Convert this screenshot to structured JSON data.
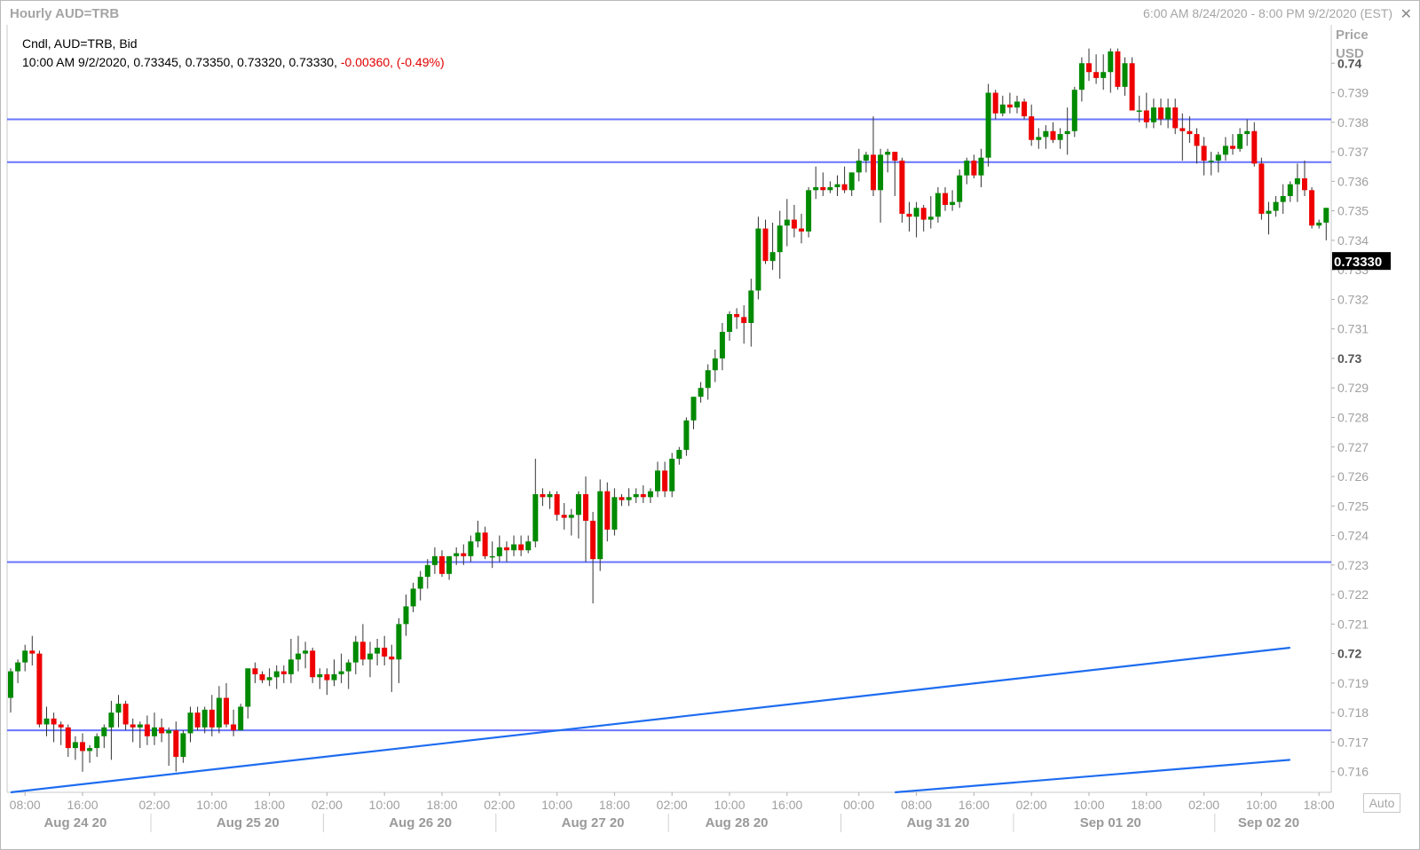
{
  "window": {
    "title": "Hourly AUD=TRB",
    "range": "6:00 AM 8/24/2020 - 8:00 PM 9/2/2020 (EST)",
    "close_icon": "close-icon"
  },
  "legend": {
    "line1": "Cndl, AUD=TRB, Bid",
    "line2_prefix": "10:00 AM 9/2/2020, 0.73345, 0.73350, 0.73320, 0.73330,",
    "change": "-0.00360, (-0.49%)"
  },
  "price_axis": {
    "header1": "Price",
    "header2": "USD",
    "current_label": "0.73330",
    "auto_label": "Auto"
  },
  "colors": {
    "up": "#008a00",
    "down": "#ee0000",
    "hline": "#6a74ff",
    "trend": "#1e6cf0",
    "badge": "#000000"
  },
  "chart_data": {
    "type": "candlestick",
    "ylim": [
      0.7153,
      0.7413
    ],
    "y_ticks": [
      "0.74",
      "0.739",
      "0.738",
      "0.737",
      "0.736",
      "0.735",
      "0.734",
      "0.733",
      "0.732",
      "0.731",
      "0.73",
      "0.729",
      "0.728",
      "0.727",
      "0.726",
      "0.725",
      "0.724",
      "0.723",
      "0.722",
      "0.721",
      "0.72",
      "0.719",
      "0.718",
      "0.717",
      "0.716"
    ],
    "major_y_ticks": [
      "0.74",
      "0.73",
      "0.72"
    ],
    "x_ticks": [
      "08:00",
      "16:00",
      "02:00",
      "10:00",
      "18:00",
      "02:00",
      "10:00",
      "18:00",
      "02:00",
      "10:00",
      "18:00",
      "02:00",
      "10:00",
      "16:00",
      "00:00",
      "08:00",
      "16:00",
      "02:00",
      "10:00",
      "18:00",
      "02:00",
      "10:00",
      "18:00"
    ],
    "date_labels": [
      "Aug 24 20",
      "Aug 25 20",
      "Aug 26 20",
      "Aug 27 20",
      "Aug 28 20",
      "Aug 31 20",
      "Sep 01 20",
      "Sep 02 20"
    ],
    "horizontal_lines": [
      0.7381,
      0.73665,
      0.7231,
      0.7174
    ],
    "trend_lines": [
      {
        "from_bar": 0,
        "from": 0.7153,
        "to_bar": 178,
        "to": 0.7202
      },
      {
        "from_bar": 123,
        "from": 0.7153,
        "to_bar": 178,
        "to": 0.7164
      }
    ],
    "candles": [
      [
        0.7185,
        0.7195,
        0.718,
        0.7194
      ],
      [
        0.7194,
        0.7198,
        0.719,
        0.7197
      ],
      [
        0.7197,
        0.7203,
        0.7194,
        0.7201
      ],
      [
        0.7201,
        0.7206,
        0.7196,
        0.72
      ],
      [
        0.72,
        0.7201,
        0.7175,
        0.7176
      ],
      [
        0.7176,
        0.7182,
        0.7172,
        0.7178
      ],
      [
        0.7178,
        0.718,
        0.717,
        0.7176
      ],
      [
        0.7176,
        0.7177,
        0.7169,
        0.7175
      ],
      [
        0.7175,
        0.7176,
        0.7165,
        0.7168
      ],
      [
        0.7168,
        0.7172,
        0.7164,
        0.717
      ],
      [
        0.717,
        0.7173,
        0.716,
        0.7167
      ],
      [
        0.7167,
        0.7169,
        0.7163,
        0.7168
      ],
      [
        0.7168,
        0.7173,
        0.7165,
        0.7172
      ],
      [
        0.7172,
        0.7176,
        0.7168,
        0.7175
      ],
      [
        0.7175,
        0.7184,
        0.7164,
        0.718
      ],
      [
        0.718,
        0.7186,
        0.7175,
        0.7183
      ],
      [
        0.7183,
        0.7184,
        0.7174,
        0.7176
      ],
      [
        0.7176,
        0.7178,
        0.717,
        0.7175
      ],
      [
        0.7175,
        0.7177,
        0.7168,
        0.7176
      ],
      [
        0.7176,
        0.7179,
        0.7169,
        0.7172
      ],
      [
        0.7172,
        0.718,
        0.7169,
        0.7175
      ],
      [
        0.7175,
        0.7178,
        0.717,
        0.7173
      ],
      [
        0.7173,
        0.7175,
        0.7162,
        0.7174
      ],
      [
        0.7174,
        0.7177,
        0.716,
        0.7165
      ],
      [
        0.7165,
        0.7174,
        0.7163,
        0.7173
      ],
      [
        0.7173,
        0.7182,
        0.717,
        0.718
      ],
      [
        0.718,
        0.7182,
        0.7174,
        0.7175
      ],
      [
        0.7175,
        0.7182,
        0.7173,
        0.7181
      ],
      [
        0.7181,
        0.7186,
        0.7172,
        0.7175
      ],
      [
        0.7175,
        0.7189,
        0.7173,
        0.7185
      ],
      [
        0.7185,
        0.719,
        0.7175,
        0.7176
      ],
      [
        0.7176,
        0.7181,
        0.7172,
        0.7174
      ],
      [
        0.7174,
        0.7183,
        0.7174,
        0.7182
      ],
      [
        0.7182,
        0.7189,
        0.7178,
        0.7195
      ],
      [
        0.7195,
        0.7197,
        0.719,
        0.7193
      ],
      [
        0.7193,
        0.7194,
        0.719,
        0.7191
      ],
      [
        0.7191,
        0.7195,
        0.7189,
        0.7192
      ],
      [
        0.7192,
        0.7196,
        0.7188,
        0.7194
      ],
      [
        0.7194,
        0.7196,
        0.719,
        0.7193
      ],
      [
        0.7193,
        0.7205,
        0.719,
        0.7198
      ],
      [
        0.7198,
        0.7206,
        0.7194,
        0.72
      ],
      [
        0.72,
        0.7204,
        0.7195,
        0.7201
      ],
      [
        0.7201,
        0.7202,
        0.719,
        0.7192
      ],
      [
        0.7192,
        0.7195,
        0.7188,
        0.7193
      ],
      [
        0.7193,
        0.7195,
        0.7186,
        0.7191
      ],
      [
        0.7191,
        0.7198,
        0.7189,
        0.7193
      ],
      [
        0.7193,
        0.72,
        0.719,
        0.7194
      ],
      [
        0.7194,
        0.7198,
        0.7188,
        0.7197
      ],
      [
        0.7197,
        0.7206,
        0.7193,
        0.7204
      ],
      [
        0.7204,
        0.721,
        0.7196,
        0.7198
      ],
      [
        0.7198,
        0.7204,
        0.7192,
        0.72
      ],
      [
        0.72,
        0.7205,
        0.7196,
        0.7202
      ],
      [
        0.7202,
        0.7206,
        0.7196,
        0.7199
      ],
      [
        0.7199,
        0.7203,
        0.7187,
        0.7198
      ],
      [
        0.7198,
        0.7212,
        0.719,
        0.721
      ],
      [
        0.721,
        0.722,
        0.7206,
        0.7216
      ],
      [
        0.7216,
        0.7224,
        0.7214,
        0.7222
      ],
      [
        0.7222,
        0.7228,
        0.7218,
        0.7226
      ],
      [
        0.7226,
        0.7232,
        0.7222,
        0.723
      ],
      [
        0.723,
        0.7236,
        0.7227,
        0.7233
      ],
      [
        0.7233,
        0.7235,
        0.7226,
        0.7227
      ],
      [
        0.7227,
        0.7233,
        0.7225,
        0.7233
      ],
      [
        0.7233,
        0.7236,
        0.723,
        0.7234
      ],
      [
        0.7234,
        0.7237,
        0.723,
        0.7233
      ],
      [
        0.7233,
        0.724,
        0.7231,
        0.7238
      ],
      [
        0.7238,
        0.7245,
        0.7236,
        0.7241
      ],
      [
        0.7241,
        0.7243,
        0.7232,
        0.7233
      ],
      [
        0.7233,
        0.7238,
        0.7229,
        0.7233
      ],
      [
        0.7233,
        0.724,
        0.7231,
        0.7236
      ],
      [
        0.7236,
        0.7238,
        0.7231,
        0.7235
      ],
      [
        0.7235,
        0.724,
        0.7233,
        0.7237
      ],
      [
        0.7237,
        0.724,
        0.7233,
        0.7235
      ],
      [
        0.7235,
        0.724,
        0.7234,
        0.7238
      ],
      [
        0.7238,
        0.7266,
        0.7236,
        0.7254
      ],
      [
        0.7254,
        0.7256,
        0.725,
        0.7253
      ],
      [
        0.7253,
        0.7255,
        0.7249,
        0.7254
      ],
      [
        0.7254,
        0.7255,
        0.7245,
        0.7247
      ],
      [
        0.7247,
        0.7251,
        0.7242,
        0.7246
      ],
      [
        0.7246,
        0.7249,
        0.724,
        0.7247
      ],
      [
        0.7247,
        0.7255,
        0.7239,
        0.7254
      ],
      [
        0.7254,
        0.726,
        0.7231,
        0.7245
      ],
      [
        0.7245,
        0.7248,
        0.7217,
        0.7232
      ],
      [
        0.7232,
        0.7259,
        0.7228,
        0.7255
      ],
      [
        0.7255,
        0.7258,
        0.7238,
        0.7242
      ],
      [
        0.7242,
        0.7256,
        0.724,
        0.7253
      ],
      [
        0.7253,
        0.7254,
        0.725,
        0.7252
      ],
      [
        0.7252,
        0.7256,
        0.725,
        0.7253
      ],
      [
        0.7253,
        0.7256,
        0.7251,
        0.7254
      ],
      [
        0.7254,
        0.7257,
        0.7251,
        0.7253
      ],
      [
        0.7253,
        0.7256,
        0.7251,
        0.7255
      ],
      [
        0.7255,
        0.7265,
        0.7253,
        0.7262
      ],
      [
        0.7262,
        0.7265,
        0.7253,
        0.7255
      ],
      [
        0.7255,
        0.7268,
        0.7253,
        0.7266
      ],
      [
        0.7266,
        0.727,
        0.7264,
        0.7269
      ],
      [
        0.7269,
        0.728,
        0.7267,
        0.7279
      ],
      [
        0.7279,
        0.7286,
        0.7276,
        0.7287
      ],
      [
        0.7287,
        0.7292,
        0.7285,
        0.729
      ],
      [
        0.729,
        0.7298,
        0.7286,
        0.7296
      ],
      [
        0.7296,
        0.7303,
        0.7292,
        0.73
      ],
      [
        0.73,
        0.7312,
        0.7296,
        0.7309
      ],
      [
        0.7309,
        0.7316,
        0.7306,
        0.7315
      ],
      [
        0.7315,
        0.7317,
        0.731,
        0.7314
      ],
      [
        0.7314,
        0.7318,
        0.7305,
        0.7312
      ],
      [
        0.7312,
        0.7327,
        0.7304,
        0.7323
      ],
      [
        0.7323,
        0.7348,
        0.732,
        0.7344
      ],
      [
        0.7344,
        0.7347,
        0.7332,
        0.7333
      ],
      [
        0.7333,
        0.7346,
        0.733,
        0.7336
      ],
      [
        0.7336,
        0.735,
        0.7327,
        0.7345
      ],
      [
        0.7345,
        0.7354,
        0.7338,
        0.7347
      ],
      [
        0.7347,
        0.7352,
        0.7341,
        0.7344
      ],
      [
        0.7344,
        0.7349,
        0.7339,
        0.7343
      ],
      [
        0.7343,
        0.7358,
        0.7341,
        0.7357
      ],
      [
        0.7357,
        0.7365,
        0.7354,
        0.7358
      ],
      [
        0.7358,
        0.7363,
        0.7355,
        0.7357
      ],
      [
        0.7357,
        0.736,
        0.7356,
        0.7358
      ],
      [
        0.7358,
        0.7362,
        0.7355,
        0.7359
      ],
      [
        0.7359,
        0.7365,
        0.7356,
        0.7357
      ],
      [
        0.7357,
        0.7363,
        0.7355,
        0.7363
      ],
      [
        0.7363,
        0.7371,
        0.736,
        0.7367
      ],
      [
        0.7367,
        0.737,
        0.7363,
        0.7369
      ],
      [
        0.7369,
        0.7382,
        0.7355,
        0.7357
      ],
      [
        0.7357,
        0.7371,
        0.7346,
        0.7369
      ],
      [
        0.7369,
        0.7371,
        0.7363,
        0.737
      ],
      [
        0.737,
        0.7367,
        0.7355,
        0.7367
      ],
      [
        0.7367,
        0.7368,
        0.7346,
        0.7349
      ],
      [
        0.7349,
        0.7353,
        0.7343,
        0.7348
      ],
      [
        0.7348,
        0.7353,
        0.7341,
        0.7351
      ],
      [
        0.7351,
        0.7352,
        0.7343,
        0.7347
      ],
      [
        0.7347,
        0.7355,
        0.7344,
        0.7348
      ],
      [
        0.7348,
        0.7358,
        0.7346,
        0.7356
      ],
      [
        0.7356,
        0.7358,
        0.735,
        0.7352
      ],
      [
        0.7352,
        0.7357,
        0.735,
        0.7353
      ],
      [
        0.7353,
        0.7364,
        0.7351,
        0.7362
      ],
      [
        0.7362,
        0.7368,
        0.7359,
        0.7367
      ],
      [
        0.7367,
        0.7369,
        0.7361,
        0.7362
      ],
      [
        0.7362,
        0.7371,
        0.7358,
        0.7368
      ],
      [
        0.7368,
        0.7393,
        0.7365,
        0.739
      ],
      [
        0.739,
        0.7391,
        0.7381,
        0.7383
      ],
      [
        0.7383,
        0.7389,
        0.7382,
        0.7386
      ],
      [
        0.7386,
        0.739,
        0.7383,
        0.7385
      ],
      [
        0.7385,
        0.7389,
        0.7383,
        0.7387
      ],
      [
        0.7387,
        0.7388,
        0.7381,
        0.7382
      ],
      [
        0.7382,
        0.7386,
        0.7372,
        0.7374
      ],
      [
        0.7374,
        0.7378,
        0.7371,
        0.7375
      ],
      [
        0.7375,
        0.7379,
        0.7371,
        0.7377
      ],
      [
        0.7377,
        0.738,
        0.7373,
        0.7374
      ],
      [
        0.7374,
        0.7378,
        0.7371,
        0.7376
      ],
      [
        0.7376,
        0.7385,
        0.7369,
        0.7377
      ],
      [
        0.7377,
        0.7392,
        0.7375,
        0.7391
      ],
      [
        0.7391,
        0.7402,
        0.7387,
        0.74
      ],
      [
        0.74,
        0.7405,
        0.7394,
        0.7397
      ],
      [
        0.7397,
        0.7403,
        0.7393,
        0.7395
      ],
      [
        0.7395,
        0.7403,
        0.7391,
        0.7397
      ],
      [
        0.7397,
        0.7405,
        0.739,
        0.7404
      ],
      [
        0.7404,
        0.7405,
        0.7391,
        0.7392
      ],
      [
        0.7392,
        0.7402,
        0.7389,
        0.74
      ],
      [
        0.74,
        0.7402,
        0.7387,
        0.7384
      ],
      [
        0.7384,
        0.7389,
        0.738,
        0.7384
      ],
      [
        0.7384,
        0.739,
        0.7378,
        0.738
      ],
      [
        0.738,
        0.7388,
        0.7378,
        0.7385
      ],
      [
        0.7385,
        0.7388,
        0.7379,
        0.7381
      ],
      [
        0.7381,
        0.7388,
        0.7378,
        0.7385
      ],
      [
        0.7385,
        0.7388,
        0.7376,
        0.7378
      ],
      [
        0.7378,
        0.7383,
        0.7367,
        0.7377
      ],
      [
        0.7377,
        0.7382,
        0.7373,
        0.7376
      ],
      [
        0.7376,
        0.7378,
        0.7366,
        0.7372
      ],
      [
        0.7372,
        0.7375,
        0.7362,
        0.7367
      ],
      [
        0.7367,
        0.737,
        0.7362,
        0.7367
      ],
      [
        0.7367,
        0.737,
        0.7363,
        0.7369
      ],
      [
        0.7369,
        0.7375,
        0.7367,
        0.7372
      ],
      [
        0.7372,
        0.7376,
        0.7369,
        0.7371
      ],
      [
        0.7371,
        0.7378,
        0.737,
        0.7376
      ],
      [
        0.7376,
        0.7381,
        0.7372,
        0.7377
      ],
      [
        0.7377,
        0.738,
        0.7365,
        0.7366
      ],
      [
        0.7366,
        0.7368,
        0.7347,
        0.7349
      ],
      [
        0.7349,
        0.7353,
        0.7342,
        0.735
      ],
      [
        0.735,
        0.7355,
        0.7348,
        0.7353
      ],
      [
        0.7353,
        0.7359,
        0.7349,
        0.7355
      ],
      [
        0.7355,
        0.736,
        0.7353,
        0.7359
      ],
      [
        0.7359,
        0.7366,
        0.7353,
        0.7361
      ],
      [
        0.7361,
        0.7367,
        0.7355,
        0.7357
      ],
      [
        0.7357,
        0.7358,
        0.7344,
        0.7345
      ],
      [
        0.7345,
        0.7347,
        0.7344,
        0.7346
      ],
      [
        0.7346,
        0.7351,
        0.734,
        0.7351
      ],
      [
        0.7351,
        0.7351,
        0.7341,
        0.7346
      ],
      [
        0.7346,
        0.7348,
        0.7336,
        0.7337
      ],
      [
        0.7337,
        0.7348,
        0.7329,
        0.7335
      ],
      [
        0.7335,
        0.7335,
        0.7332,
        0.7333
      ]
    ]
  }
}
